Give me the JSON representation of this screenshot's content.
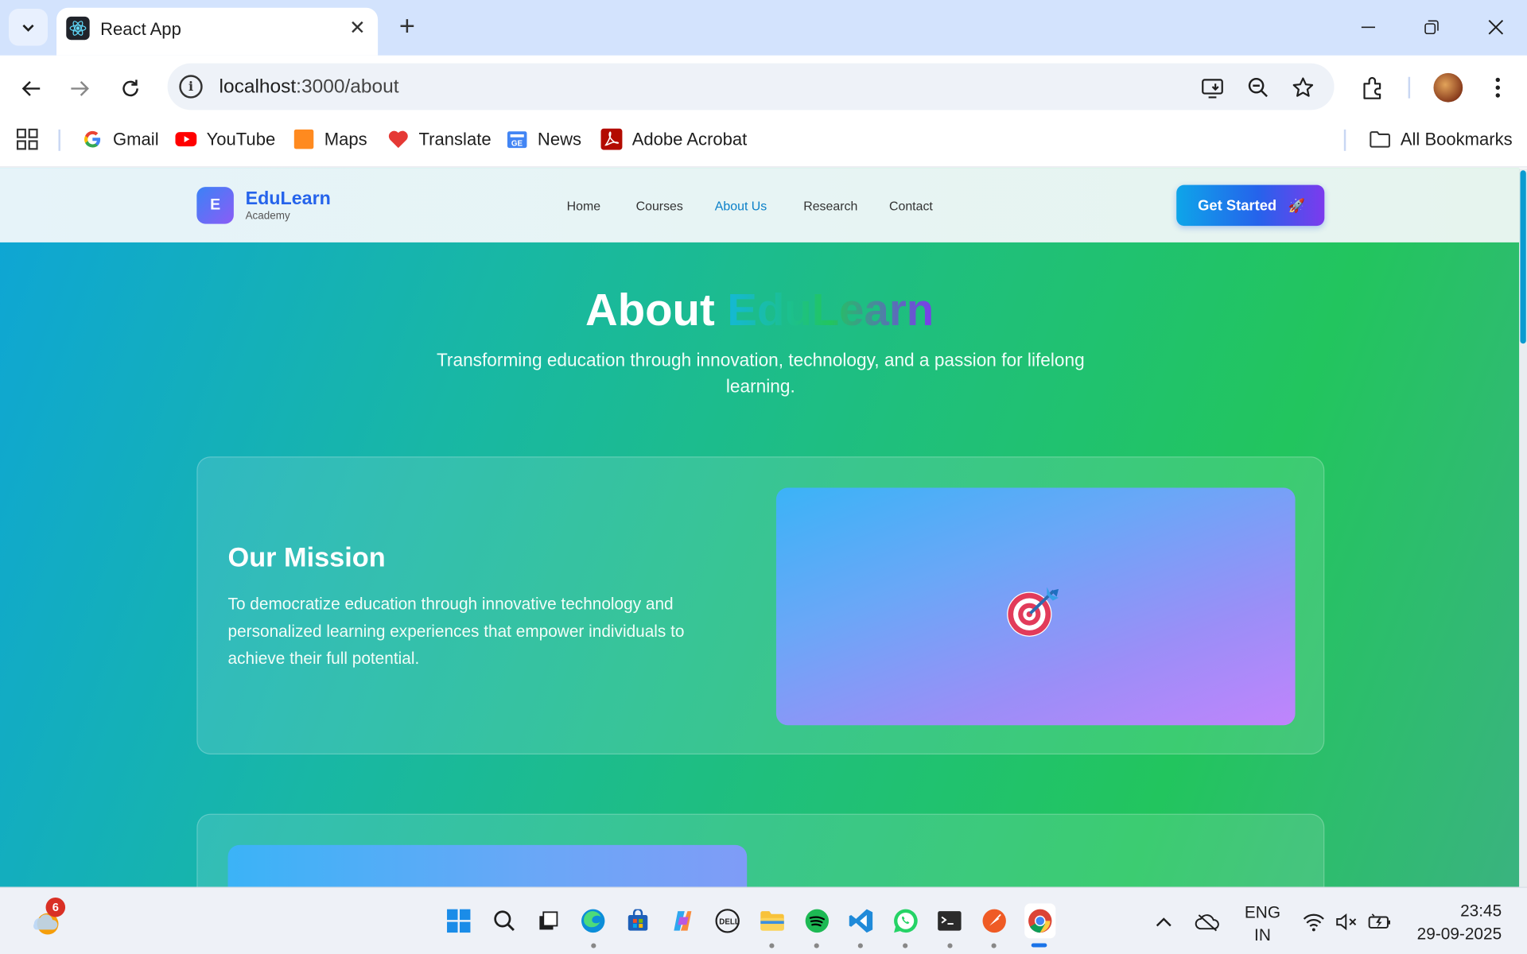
{
  "browser": {
    "tab_title": "React App",
    "url_host": "localhost",
    "url_path": ":3000/about",
    "bookmarks": [
      {
        "label": "Gmail"
      },
      {
        "label": "YouTube"
      },
      {
        "label": "Maps"
      },
      {
        "label": "Translate"
      },
      {
        "label": "News"
      },
      {
        "label": "Adobe Acrobat"
      }
    ],
    "all_bookmarks": "All Bookmarks"
  },
  "site": {
    "logo_letter": "E",
    "logo_name": "EduLearn",
    "logo_sub": "Academy",
    "nav": [
      {
        "label": "Home",
        "active": false
      },
      {
        "label": "Courses",
        "active": false
      },
      {
        "label": "About Us",
        "active": true
      },
      {
        "label": "Research",
        "active": false
      },
      {
        "label": "Contact",
        "active": false
      }
    ],
    "cta_label": "Get Started",
    "cta_icon": "🚀"
  },
  "hero": {
    "title_prefix": "About",
    "title_brand": "EduLearn",
    "subtitle": "Transforming education through innovation, technology, and a passion for lifelong learning."
  },
  "mission": {
    "title": "Our Mission",
    "text": "To democratize education through innovative technology and personalized learning experiences that empower individuals to achieve their full potential.",
    "icon": "🎯"
  },
  "taskbar": {
    "weather_badge": "6",
    "lang_line1": "ENG",
    "lang_line2": "IN",
    "time": "23:45",
    "date": "29-09-2025"
  },
  "colors": {
    "accent": "#2563eb",
    "active_nav": "#0b80c8",
    "page_gradient_start": "#0ea5d6",
    "page_gradient_end": "#22c55e"
  }
}
